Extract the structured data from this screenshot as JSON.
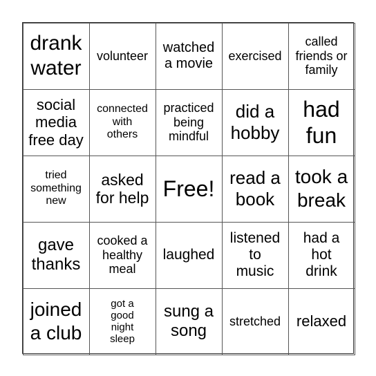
{
  "card": {
    "cells": [
      "drank\nwater",
      "volunteer",
      "watched\na movie",
      "exercised",
      "called\nfriends or\nfamily",
      "social\nmedia\nfree day",
      "connected\nwith\nothers",
      "practiced\nbeing\nmindful",
      "did a\nhobby",
      "had\nfun",
      "tried\nsomething\nnew",
      "asked\nfor help",
      "Free!",
      "read a\nbook",
      "took a\nbreak",
      "gave\nthanks",
      "cooked a\nhealthy\nmeal",
      "laughed",
      "listened\nto\nmusic",
      "had a\nhot\ndrink",
      "joined\na club",
      "got a\ngood\nnight\nsleep",
      "sung a\nsong",
      "stretched",
      "relaxed"
    ]
  }
}
